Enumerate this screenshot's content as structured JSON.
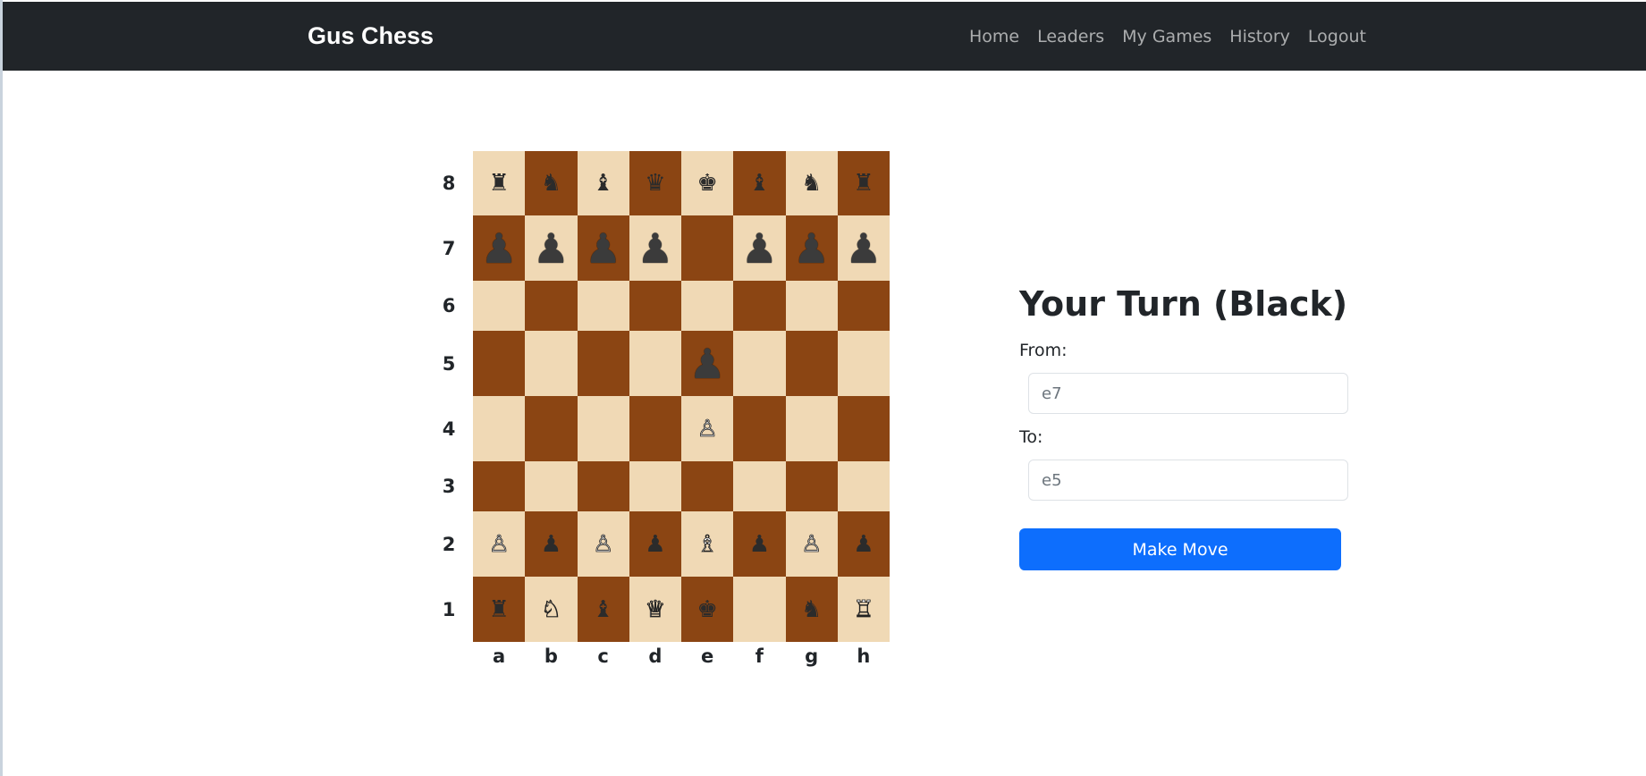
{
  "app": {
    "brand": "Gus Chess"
  },
  "nav": {
    "items": [
      {
        "label": "Home"
      },
      {
        "label": "Leaders"
      },
      {
        "label": "My Games"
      },
      {
        "label": "History"
      },
      {
        "label": "Logout"
      }
    ]
  },
  "board": {
    "ranks": [
      "8",
      "7",
      "6",
      "5",
      "4",
      "3",
      "2",
      "1"
    ],
    "files": [
      "a",
      "b",
      "c",
      "d",
      "e",
      "f",
      "g",
      "h"
    ],
    "light_color": "#f0d9b5",
    "dark_color": "#8b4513",
    "squares": [
      [
        "♜",
        "♞",
        "♝",
        "♛",
        "♚",
        "♝",
        "♞",
        "♜"
      ],
      [
        "♟",
        "♟",
        "♟",
        "♟",
        "",
        "♟",
        "♟",
        "♟"
      ],
      [
        "",
        "",
        "",
        "",
        "",
        "",
        "",
        ""
      ],
      [
        "",
        "",
        "",
        "",
        "♟",
        "",
        "",
        ""
      ],
      [
        "",
        "",
        "",
        "",
        "♙",
        "",
        "",
        ""
      ],
      [
        "",
        "",
        "",
        "",
        "",
        "",
        "",
        ""
      ],
      [
        "♙",
        "♟",
        "♙",
        "♟",
        "♗",
        "♟",
        "♙",
        "♟"
      ],
      [
        "♜",
        "♘",
        "♝",
        "♕",
        "♚",
        "",
        "♞",
        "♖"
      ]
    ]
  },
  "panel": {
    "turn_heading": "Your Turn (Black)",
    "from_label": "From:",
    "from_placeholder": "e7",
    "to_label": "To:",
    "to_placeholder": "e5",
    "submit_label": "Make Move",
    "accent_color": "#0d6efd"
  }
}
